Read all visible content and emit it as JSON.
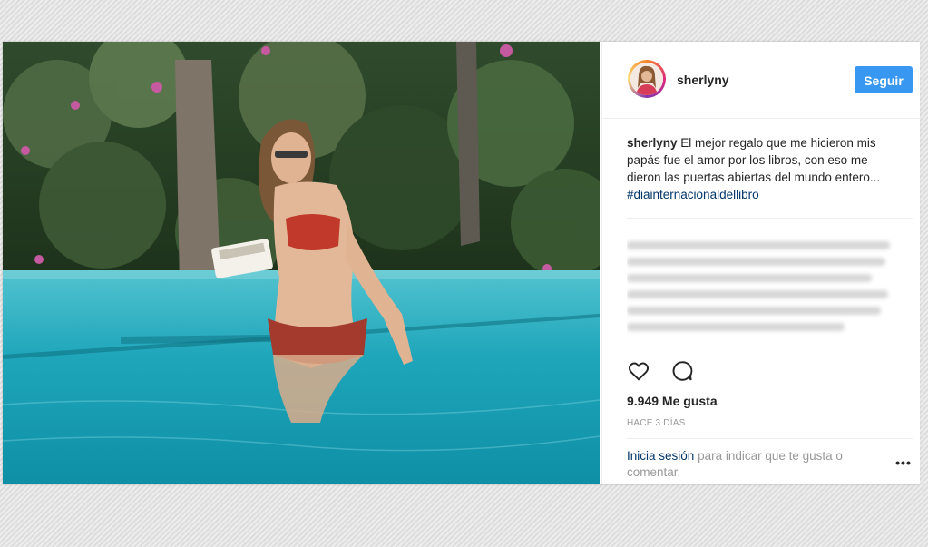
{
  "post": {
    "username": "sherlyny",
    "follow_label": "Seguir",
    "caption": {
      "username": "sherlyny",
      "text": "El mejor regalo que me hicieron mis papás fue el amor por los libros, con eso me dieron las puertas abiertas del mundo entero...",
      "hashtag": "#diainternacionaldellibro"
    },
    "likes": "9.949 Me gusta",
    "time": "HACE 3 DÍAS",
    "login": {
      "link": "Inicia sesión",
      "rest": "para indicar que te gusta o comentar."
    },
    "more_icon": "•••"
  },
  "icons": {
    "like": "heart-icon",
    "comment": "speech-bubble-icon",
    "more": "ellipsis-icon"
  },
  "colors": {
    "accent": "#3897f0",
    "link": "#003569",
    "pool": "#1fa4b8"
  }
}
